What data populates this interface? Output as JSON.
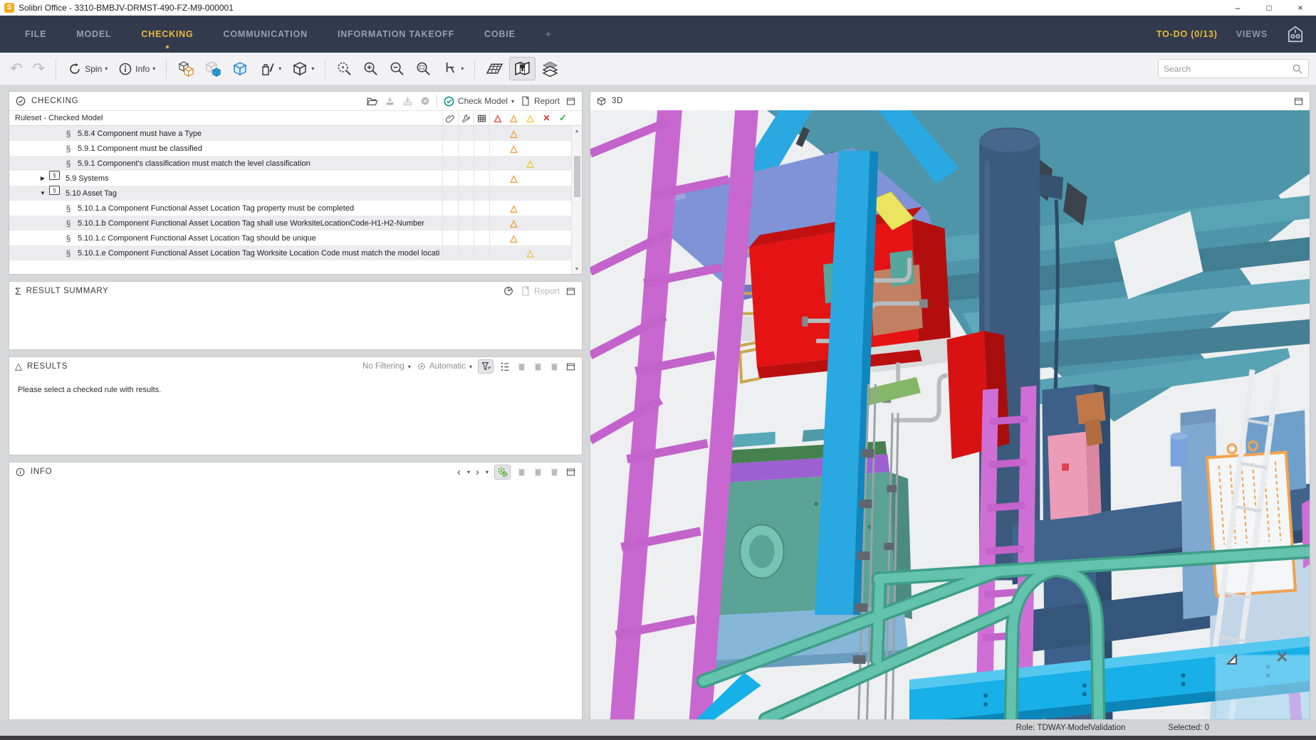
{
  "window": {
    "title": "Solibri Office - 3310-BMBJV-DRMST-490-FZ-M9-000001",
    "logo_letter": "S",
    "controls": {
      "minimize": "–",
      "maximize": "□",
      "close": "×"
    }
  },
  "menu": {
    "items": [
      "FILE",
      "MODEL",
      "CHECKING",
      "COMMUNICATION",
      "INFORMATION TAKEOFF",
      "COBIE",
      "+"
    ],
    "active_item": "CHECKING",
    "todo_label": "TO-DO (0/13)",
    "views_label": "VIEWS"
  },
  "toolbar": {
    "undo_glyph": "↶",
    "redo_glyph": "↷",
    "spin_label": "Spin",
    "info_label": "Info",
    "search_placeholder": "Search"
  },
  "checking_panel": {
    "title": "CHECKING",
    "check_model_label": "Check Model",
    "report_label": "Report",
    "tree_header": "Ruleset - Checked Model",
    "header_markers": {
      "triangle": "△",
      "cross": "✕",
      "check": "✓"
    },
    "rows": [
      {
        "indent": 2,
        "icon": "rule",
        "expand": "",
        "label": "5.8.4 Component must have a Type",
        "result": "orange"
      },
      {
        "indent": 2,
        "icon": "rule",
        "expand": "",
        "label": "5.9.1 Component must be classified",
        "result": "orange"
      },
      {
        "indent": 2,
        "icon": "rule",
        "expand": "",
        "label": "5.9.1 Component's classification must match the level classification",
        "result": "yellow"
      },
      {
        "indent": 1,
        "icon": "folder",
        "expand": "collapsed",
        "label": "5.9 Systems",
        "result": "orange"
      },
      {
        "indent": 1,
        "icon": "folder",
        "expand": "expanded",
        "label": "5.10 Asset Tag",
        "result": null
      },
      {
        "indent": 2,
        "icon": "rule",
        "expand": "",
        "label": "5.10.1.a Component Functional Asset Location Tag property must be completed",
        "result": "orange"
      },
      {
        "indent": 2,
        "icon": "rule",
        "expand": "",
        "label": "5.10.1.b Component Functional Asset Location Tag shall use WorksiteLocationCode-H1-H2-Number",
        "result": "orange"
      },
      {
        "indent": 2,
        "icon": "rule",
        "expand": "",
        "label": "5.10.1.c Component Functional Asset Location Tag should be unique",
        "result": "orange"
      },
      {
        "indent": 2,
        "icon": "rule",
        "expand": "",
        "label": "5.10.1.e Component Functional Asset Location Tag Worksite Location Code must match the model locati",
        "result": "yellow"
      }
    ]
  },
  "result_summary_panel": {
    "title": "RESULT SUMMARY",
    "sigma_glyph": "Σ",
    "report_label": "Report"
  },
  "results_panel": {
    "title": "RESULTS",
    "triangle_glyph": "△",
    "filtering_label": "No Filtering",
    "automatic_label": "Automatic",
    "empty_message": "Please select a checked rule with results."
  },
  "info_panel": {
    "title": "INFO",
    "nav_left": "‹",
    "nav_right": "›"
  },
  "viewport_panel": {
    "title": "3D"
  },
  "status_bar": {
    "role": "Role: TDWAY-ModelValidation",
    "selected": "Selected: 0"
  },
  "icons": {
    "app-logo": "orange square with S",
    "spin-icon": "circular rotate arrows",
    "info-icon": "i in circle",
    "map-pin-icon": "folded map with pin (active)",
    "layers-icon": "stacked layers",
    "check-model-icon": "teal circled check",
    "report-icon": "document with green plus",
    "gears-icon": "green double gear"
  },
  "colors": {
    "menubar_bg": "#323b4d",
    "accent_gold": "#e9ba3e",
    "severity_red": "#e23c32",
    "severity_orange": "#f09a28",
    "severity_yellow": "#edc52f",
    "pass_green": "#2fae3f",
    "check_model_teal": "#0d8b8b"
  }
}
